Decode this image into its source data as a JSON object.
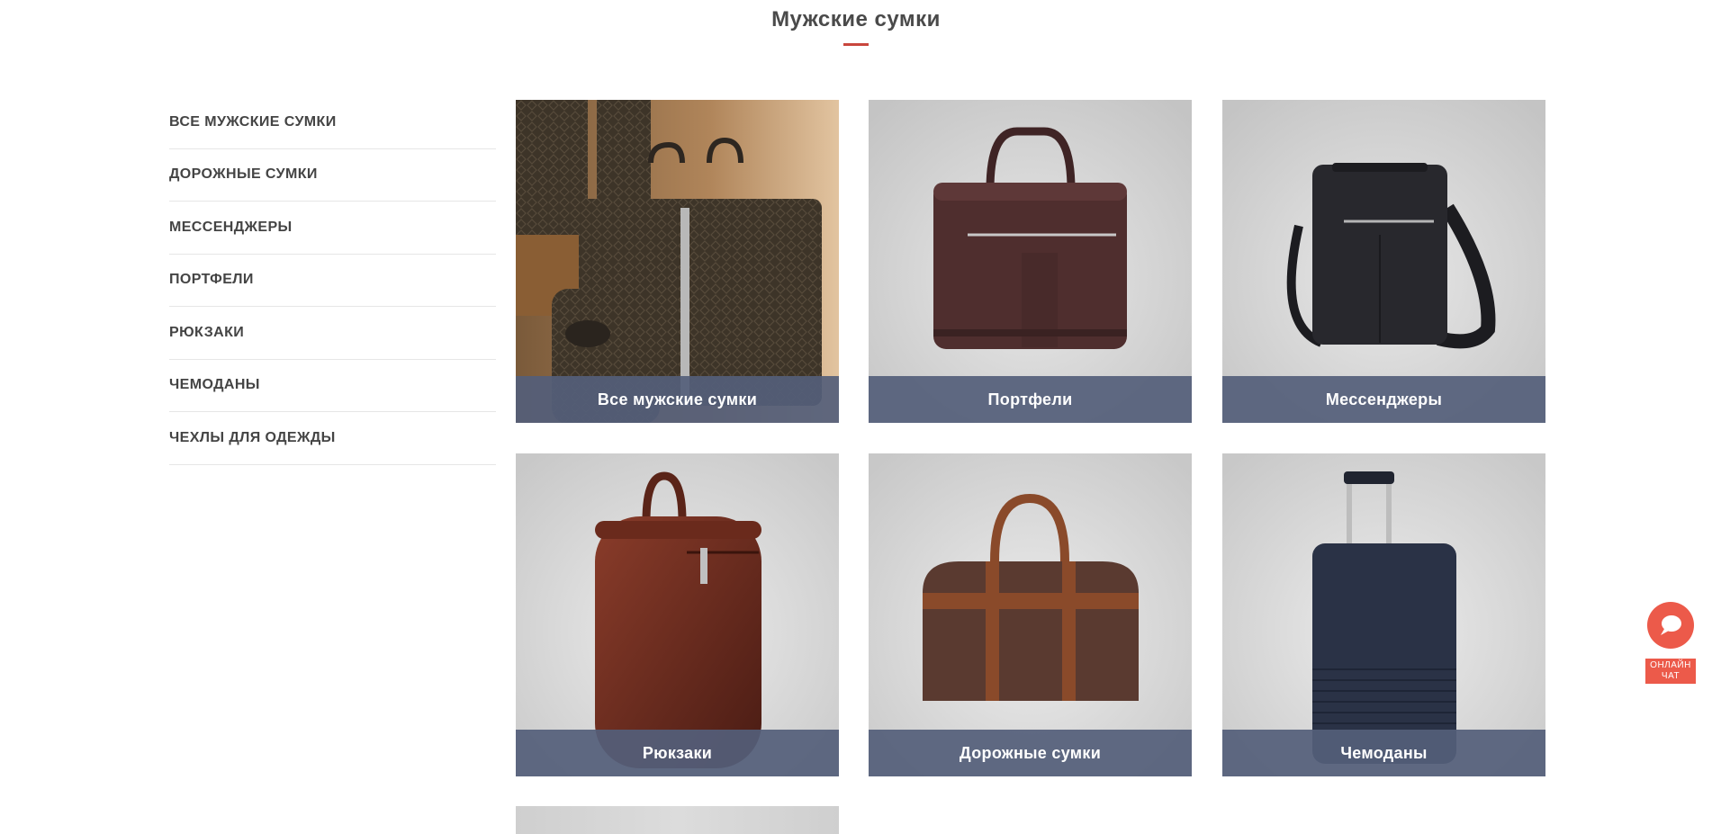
{
  "page": {
    "title": "Мужские сумки"
  },
  "colors": {
    "accent": "#c9463d",
    "caption_bg": "#545e7a",
    "chat": "#ec5a4a",
    "text": "#444444"
  },
  "sidebar": {
    "items": [
      {
        "label": "ВСЕ МУЖСКИЕ СУМКИ"
      },
      {
        "label": "ДОРОЖНЫЕ СУМКИ"
      },
      {
        "label": "МЕССЕНДЖЕРЫ"
      },
      {
        "label": "ПОРТФЕЛИ"
      },
      {
        "label": "РЮКЗАКИ"
      },
      {
        "label": "ЧЕМОДАНЫ"
      },
      {
        "label": "ЧЕХЛЫ ДЛЯ ОДЕЖДЫ"
      }
    ]
  },
  "tiles": [
    {
      "caption": "Все мужские сумки",
      "image": "monogram-bag-set"
    },
    {
      "caption": "Портфели",
      "image": "brown-briefcase"
    },
    {
      "caption": "Мессенджеры",
      "image": "black-messenger-bag"
    },
    {
      "caption": "Рюкзаки",
      "image": "brown-leather-backpack"
    },
    {
      "caption": "Дорожные сумки",
      "image": "brown-duffel-bag"
    },
    {
      "caption": "Чемоданы",
      "image": "navy-suitcase"
    },
    {
      "caption": "",
      "image": "garment-cover-partial"
    }
  ],
  "chat": {
    "label_line1": "ОНЛАЙН",
    "label_line2": "ЧАТ",
    "icon": "chat-bubble-icon"
  }
}
